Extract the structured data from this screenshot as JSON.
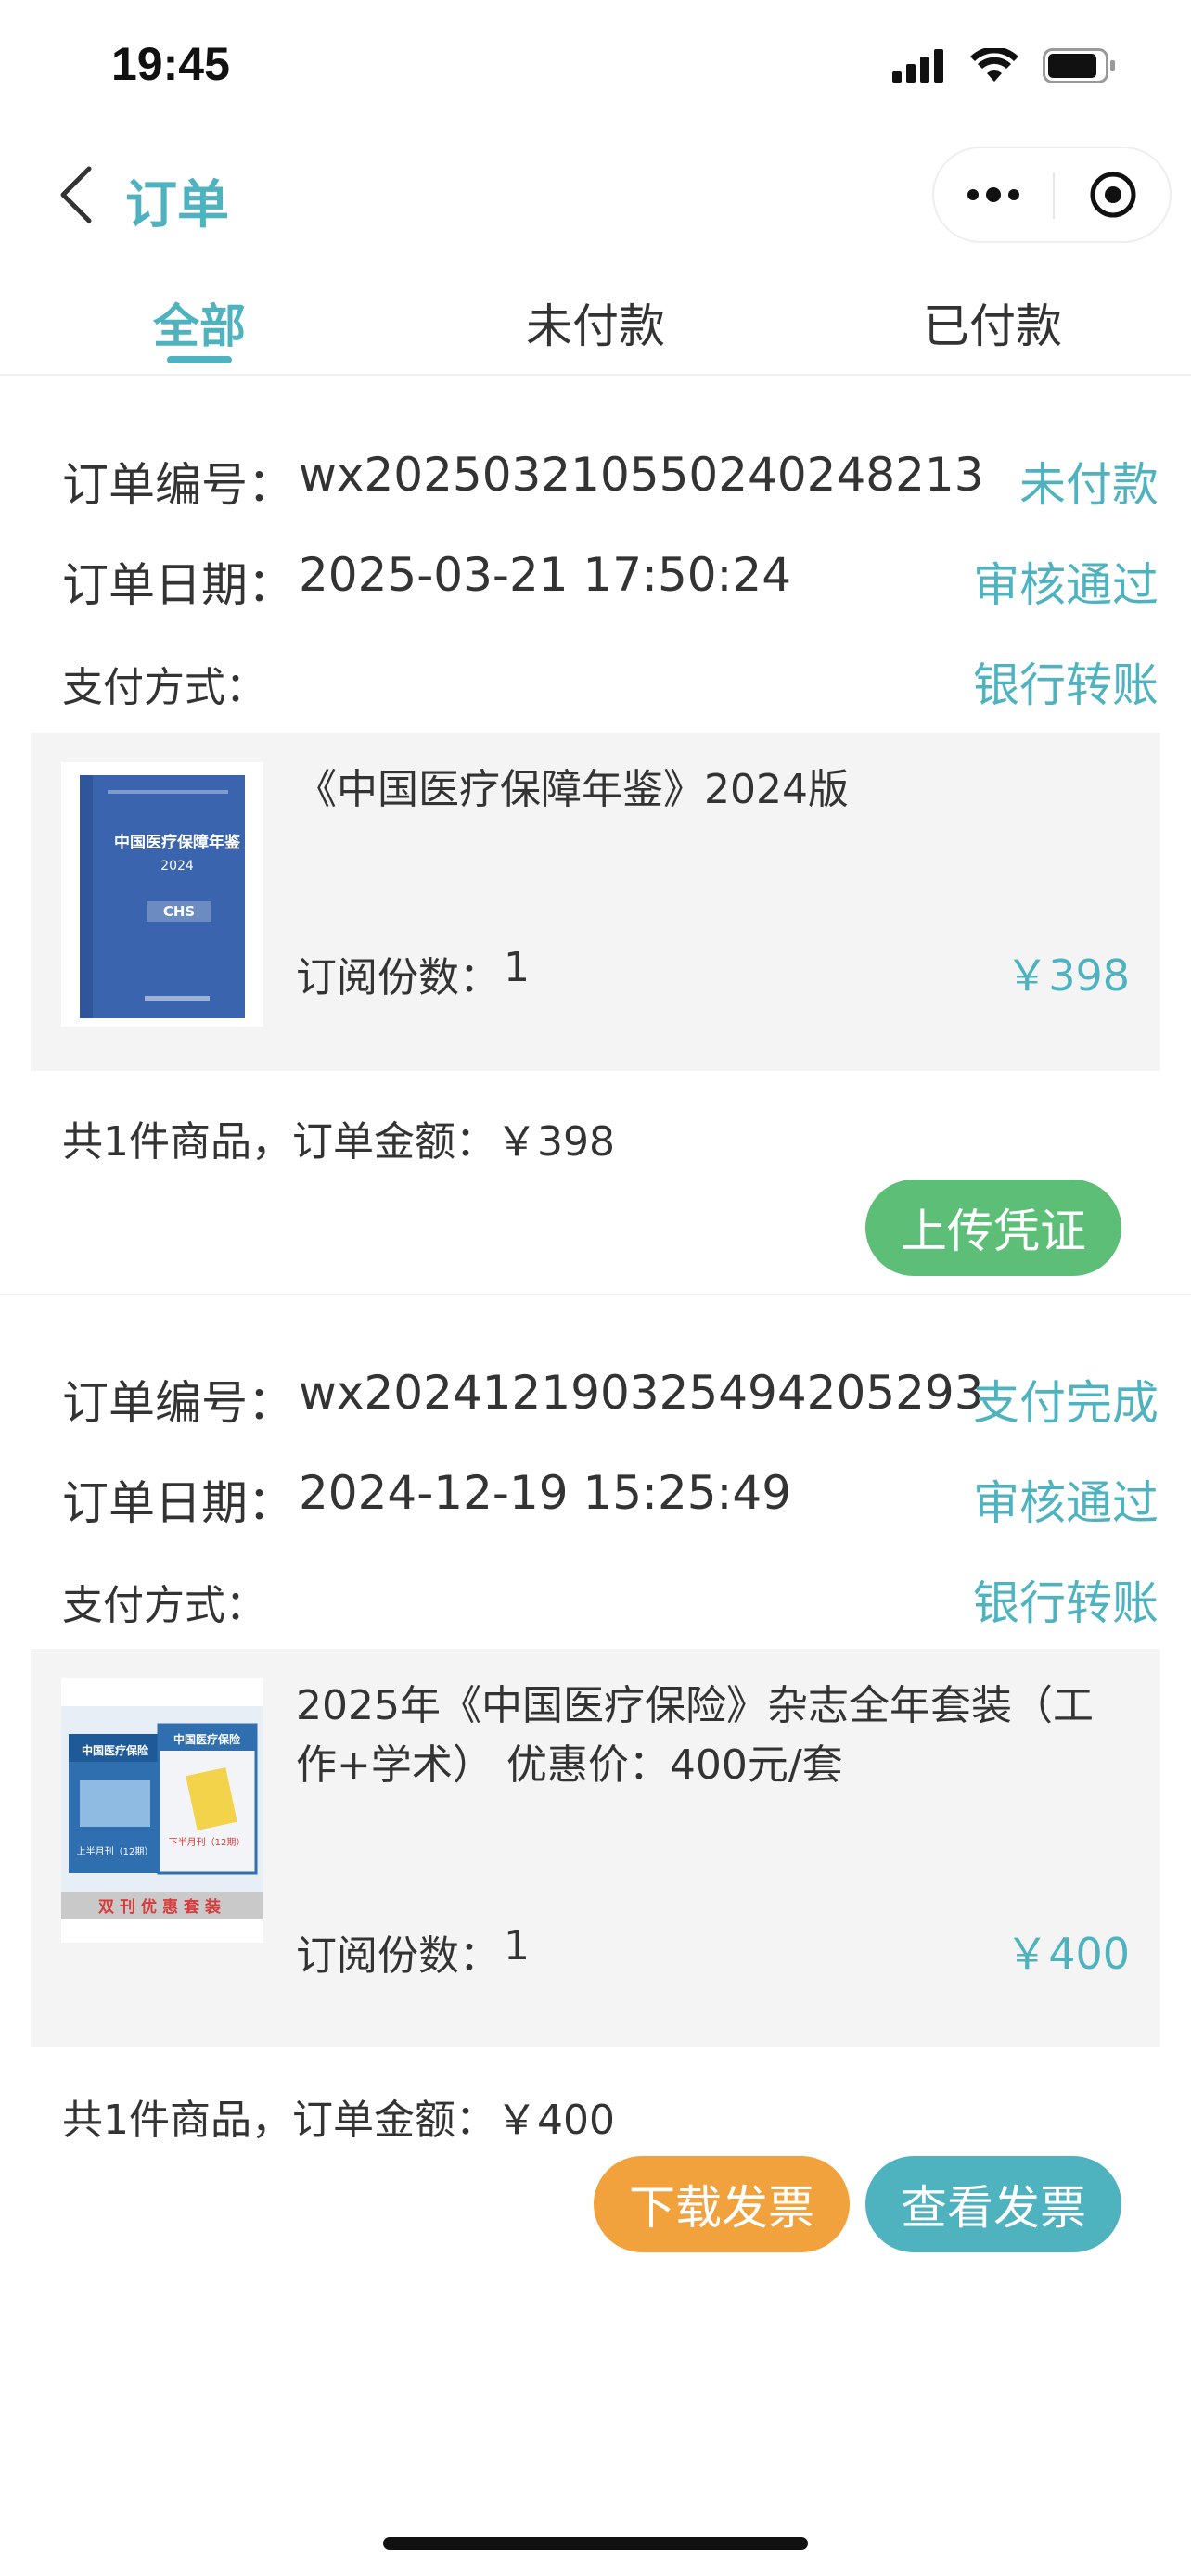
{
  "status_bar": {
    "time": "19:45"
  },
  "nav": {
    "title": "订单"
  },
  "tabs": [
    {
      "label": "全部",
      "active": true
    },
    {
      "label": "未付款",
      "active": false
    },
    {
      "label": "已付款",
      "active": false
    }
  ],
  "labels": {
    "order_no": "订单编号：",
    "order_date": "订单日期：",
    "payment": "支付方式：",
    "qty": "订阅份数："
  },
  "orders": [
    {
      "order_no": "wx2025032105502402482​13",
      "order_date": "2025-03-21 17:50:24",
      "pay_status": "未付款",
      "review_status": "审核通过",
      "payment_method": "银行转账",
      "product": {
        "name": "《中国医疗保障年鉴》2024版",
        "qty": "1",
        "price": "￥398",
        "cover": {
          "title": "中国医疗保障年鉴",
          "year": "2024",
          "logo": "CHS",
          "color": "#3a64ad"
        }
      },
      "summary": "共1件商品，订单金额：￥398",
      "buttons": [
        {
          "label": "上传凭证",
          "color": "#5dbf77"
        }
      ]
    },
    {
      "order_no": "wx202412190325494205293",
      "order_date": "2024-12-19 15:25:49",
      "pay_status": "支付完成",
      "review_status": "审核通过",
      "payment_method": "银行转账",
      "product": {
        "name": "2025年《中国医疗保险》杂志全年套装（工作+学术） 优惠价：400元/套",
        "qty": "1",
        "price": "￥400",
        "cover": {
          "magazine_title": "中国医疗保险",
          "left_label": "上半月刊（12期）",
          "right_label": "下半月刊（12期）",
          "banner": "双刊优惠套装",
          "color": "#2f6fb0"
        }
      },
      "summary": "共1件商品，订单金额：￥400",
      "buttons": [
        {
          "label": "下载发票",
          "color": "#f2a23c"
        },
        {
          "label": "查看发票",
          "color": "#4fb3bf"
        }
      ]
    }
  ]
}
